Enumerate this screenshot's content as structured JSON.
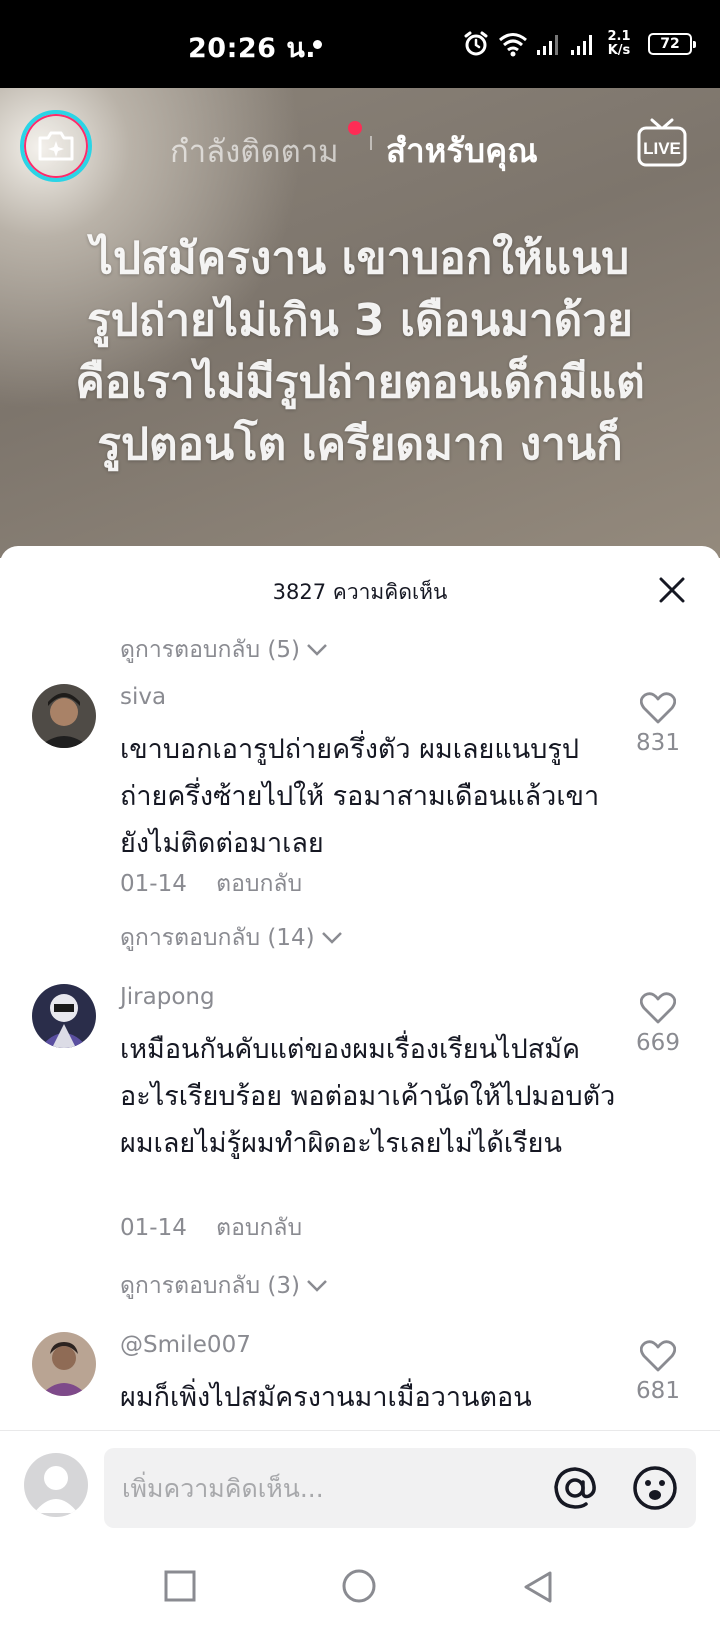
{
  "status_bar": {
    "time": "20:26 น.",
    "net_speed_value": "2.1",
    "net_speed_unit": "K/s",
    "battery": "72"
  },
  "video": {
    "tabs": {
      "following": "กำลังติดตาม",
      "for_you": "สำหรับคุณ"
    },
    "live_label": "LIVE",
    "caption_lines": [
      "ไปสมัครงาน เขาบอกให้แนบ",
      "รูปถ่ายไม่เกิน 3 เดือนมาด้วย",
      "คือเราไม่มีรูปถ่ายตอนเด็กมีแต่",
      "รูปตอนโต เครียดมาก งานก็"
    ]
  },
  "comments_sheet": {
    "count_label": "3827 ความคิดเห็น",
    "view_replies_top": "ดูการตอบกลับ (5)",
    "comments": [
      {
        "username": "siva",
        "text": "เขาบอกเอารูปถ่ายครึ่งตัว ผมเลยแนบรูปถ่ายครึ่งซ้ายไปให้ รอมาสามเดือนแล้วเขายังไม่ติดต่อมาเลย",
        "date": "01-14",
        "reply_label": "ตอบกลับ",
        "likes": "831",
        "view_replies": "ดูการตอบกลับ (14)"
      },
      {
        "username": "Jirapong",
        "text": "เหมือนกันคับแต่ของผมเรื่องเรียนไปสมัคอะไรเรียบร้อย พอต่อมาเค้านัดให้ไปมอบตัวผมเลยไม่รู้ผมทำผิดอะไรเลยไม่ได้เรียน",
        "date": "01-14",
        "reply_label": "ตอบกลับ",
        "likes": "669",
        "view_replies": "ดูการตอบกลับ (3)"
      },
      {
        "username": "@Smile007",
        "text": "ผมก็เพิ่งไปสมัครงานมาเมื่อวานตอน",
        "likes": "681"
      }
    ]
  },
  "input_bar": {
    "placeholder": "เพิ่มความคิดเห็น..."
  },
  "colors": {
    "accent_red": "#fe2c55",
    "camera_ring": "#2ad4e6",
    "secondary_text": "#8a8b91",
    "primary_text": "#161823"
  }
}
